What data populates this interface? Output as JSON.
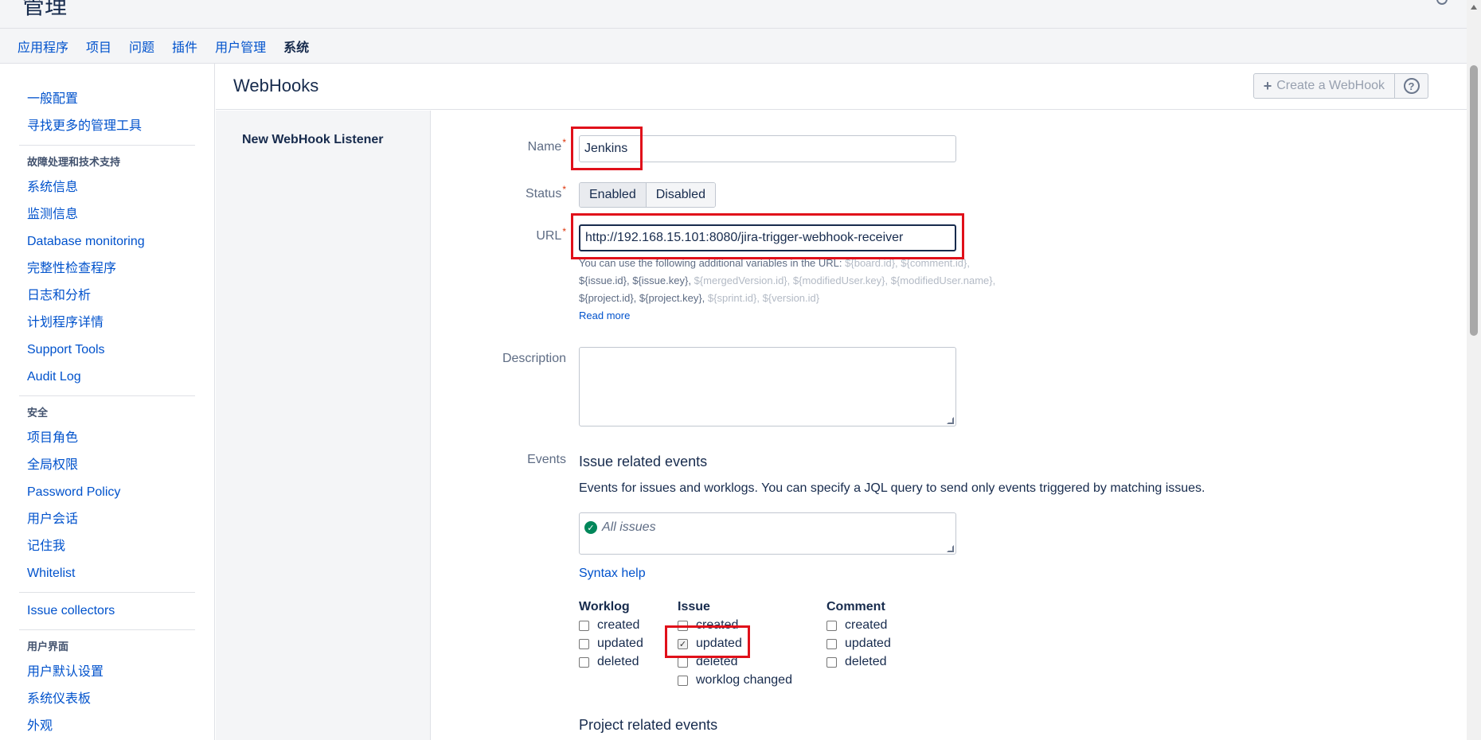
{
  "topbar": {
    "cut_title": "管理"
  },
  "admin_nav": {
    "items": [
      {
        "label": "应用程序",
        "active": false
      },
      {
        "label": "项目",
        "active": false
      },
      {
        "label": "问题",
        "active": false
      },
      {
        "label": "插件",
        "active": false
      },
      {
        "label": "用户管理",
        "active": false
      },
      {
        "label": "系统",
        "active": true
      }
    ]
  },
  "sidebar": {
    "top_links": [
      "一般配置",
      "寻找更多的管理工具"
    ],
    "troubleshooting_heading": "故障处理和技术支持",
    "troubleshooting_links": [
      "系统信息",
      "监测信息",
      "Database monitoring",
      "完整性检查程序",
      "日志和分析",
      "计划程序详情",
      "Support Tools",
      "Audit Log"
    ],
    "security_heading": "安全",
    "security_links": [
      "项目角色",
      "全局权限",
      "Password Policy",
      "用户会话",
      "记住我",
      "Whitelist"
    ],
    "issue_collectors": "Issue collectors",
    "ui_heading": "用户界面",
    "ui_links": [
      "用户默认设置",
      "系统仪表板",
      "外观"
    ]
  },
  "page": {
    "title": "WebHooks",
    "create_button": "Create a WebHook",
    "help_glyph": "?",
    "subtitle": "New WebHook Listener"
  },
  "form": {
    "name_label": "Name",
    "name_value": "Jenkins",
    "status_label": "Status",
    "status_enabled": "Enabled",
    "status_disabled": "Disabled",
    "required_mark": "*",
    "url_label": "URL",
    "url_value": "http://192.168.15.101:8080/jira-trigger-webhook-receiver",
    "url_hint_lead": "You can use the following additional variables in the URL:",
    "url_vars_muted_1": "${board.id}, ${comment.id},",
    "url_vars_1": "${issue.id}, ${issue.key},",
    "url_vars_muted_2": "${mergedVersion.id}, ${modifiedUser.key}, ${modifiedUser.name},",
    "url_vars_2": "${project.id}, ${project.key},",
    "url_vars_muted_3": "${sprint.id}, ${version.id}",
    "read_more": "Read more",
    "description_label": "Description",
    "events_label": "Events",
    "issue_events_title": "Issue related events",
    "issue_events_desc": "Events for issues and worklogs. You can specify a JQL query to send only events triggered by matching issues.",
    "jql_placeholder": "All issues",
    "syntax_help": "Syntax help",
    "project_events_title": "Project related events"
  },
  "events": {
    "worklog": {
      "title": "Worklog",
      "items": [
        {
          "label": "created",
          "checked": false
        },
        {
          "label": "updated",
          "checked": false
        },
        {
          "label": "deleted",
          "checked": false
        }
      ]
    },
    "issue": {
      "title": "Issue",
      "items": [
        {
          "label": "created",
          "checked": false
        },
        {
          "label": "updated",
          "checked": true
        },
        {
          "label": "deleted",
          "checked": false
        },
        {
          "label": "worklog changed",
          "checked": false
        }
      ]
    },
    "comment": {
      "title": "Comment",
      "items": [
        {
          "label": "created",
          "checked": false
        },
        {
          "label": "updated",
          "checked": false
        },
        {
          "label": "deleted",
          "checked": false
        }
      ]
    }
  },
  "icons": {
    "create": "plus-icon",
    "help": "question-icon",
    "jql_ok": "check-circle-icon",
    "check": "✓"
  },
  "colors": {
    "link": "#0052cc",
    "highlight_box": "#e0101a",
    "jql_ok": "#00875a"
  }
}
